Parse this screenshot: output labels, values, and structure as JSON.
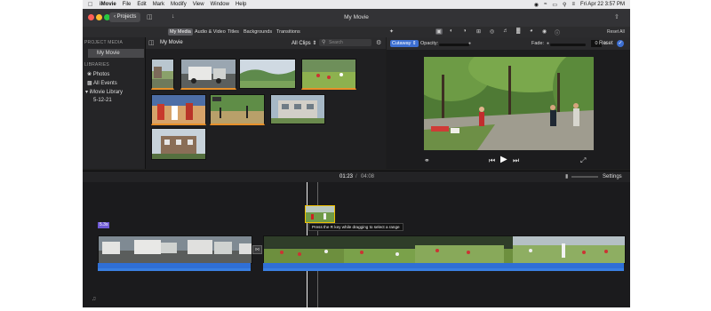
{
  "menubar": {
    "items": [
      "iMovie",
      "File",
      "Edit",
      "Mark",
      "Modify",
      "View",
      "Window",
      "Help"
    ],
    "datetime": "Fri Apr 22  3:57 PM"
  },
  "titlebar": {
    "projects_label": "Projects",
    "window_title": "My Movie"
  },
  "toolbar": {
    "tabs": [
      "My Media",
      "Audio & Video",
      "Titles",
      "Backgrounds",
      "Transitions"
    ],
    "reset_all_label": "Reset All"
  },
  "sidebar": {
    "project_media_header": "PROJECT MEDIA",
    "project_item": "My Movie",
    "libraries_header": "LIBRARIES",
    "photos": "Photos",
    "all_events": "All Events",
    "library": "iMovie Library",
    "event": "5-12-21"
  },
  "browser": {
    "title": "My Movie",
    "filter": "All Clips",
    "search_placeholder": "Search",
    "thumbs": [
      {
        "scene": "street",
        "used": true
      },
      {
        "scene": "truck",
        "used": true
      },
      {
        "scene": "hills",
        "used": false
      },
      {
        "scene": "field",
        "used": true
      },
      {
        "scene": "court",
        "used": true
      },
      {
        "scene": "trees",
        "used": true
      },
      {
        "scene": "park",
        "used": false
      },
      {
        "scene": "building",
        "used": false
      }
    ]
  },
  "viewer": {
    "mode": "Cutaway",
    "opacity_label": "Opacity:",
    "fade_label": "Fade:",
    "fade_value": "0",
    "fade_unit": "s",
    "reset_label": "Reset"
  },
  "timeline": {
    "current_time": "01:23",
    "separator": "/",
    "total_time": "04:08",
    "settings_label": "Settings",
    "clip_label": "5.3s",
    "tooltip": "Press the R key while dragging to select a range"
  },
  "colors": {
    "accent": "#3d6fd1",
    "audio": "#2f6fd6",
    "used_marker": "#e8902a"
  }
}
